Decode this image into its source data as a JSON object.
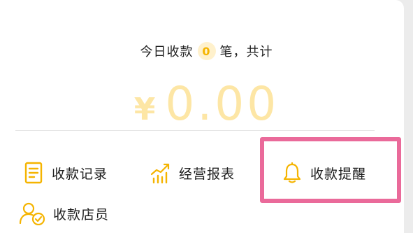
{
  "summary": {
    "prefix": "今日收款",
    "count": "0",
    "suffix": "笔，共计"
  },
  "amount": {
    "currency": "¥",
    "value": "0.00"
  },
  "actions": [
    {
      "label": "收款记录",
      "icon": "document-icon"
    },
    {
      "label": "经营报表",
      "icon": "chart-icon"
    },
    {
      "label": "收款提醒",
      "icon": "bell-icon"
    },
    {
      "label": "收款店员",
      "icon": "staff-icon"
    }
  ],
  "colors": {
    "accent": "#f5b400",
    "amount": "#fde6a5",
    "highlight": "#ea6a9a"
  }
}
